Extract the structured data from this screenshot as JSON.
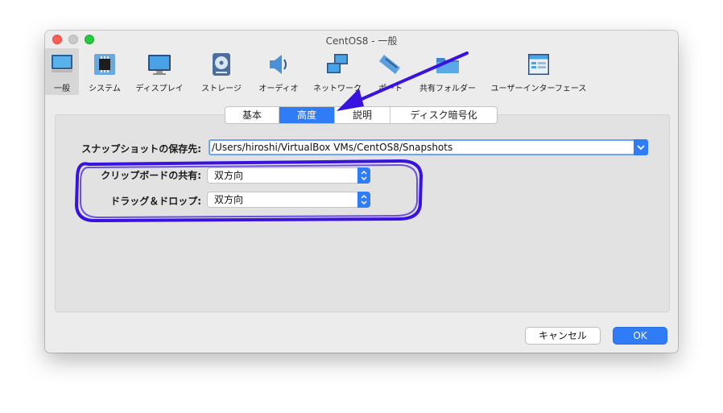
{
  "window": {
    "title": "CentOS8 - 一般"
  },
  "toolbar": {
    "items": [
      {
        "label": "一般",
        "icon": "monitor-icon",
        "selected": true
      },
      {
        "label": "システム",
        "icon": "chip-icon"
      },
      {
        "label": "ディスプレイ",
        "icon": "display-icon"
      },
      {
        "label": "ストレージ",
        "icon": "disk-icon"
      },
      {
        "label": "オーディオ",
        "icon": "speaker-icon"
      },
      {
        "label": "ネットワーク",
        "icon": "network-icon"
      },
      {
        "label": "ポート",
        "icon": "port-icon"
      },
      {
        "label": "共有フォルダー",
        "icon": "folder-icon"
      },
      {
        "label": "ユーザーインターフェース",
        "icon": "ui-icon"
      }
    ]
  },
  "tabs": [
    {
      "label": "基本"
    },
    {
      "label": "高度",
      "active": true
    },
    {
      "label": "説明"
    },
    {
      "label": "ディスク暗号化"
    }
  ],
  "form": {
    "snapshot_label": "スナップショットの保存先:",
    "snapshot_value": "/Users/hiroshi/VirtualBox VMs/CentOS8/Snapshots",
    "clipboard_label": "クリップボードの共有:",
    "clipboard_value": "双方向",
    "dragdrop_label": "ドラッグ＆ドロップ:",
    "dragdrop_value": "双方向"
  },
  "buttons": {
    "cancel": "キャンセル",
    "ok": "OK"
  },
  "colors": {
    "accent": "#2f7cf6",
    "annotation": "#3a12e0"
  }
}
